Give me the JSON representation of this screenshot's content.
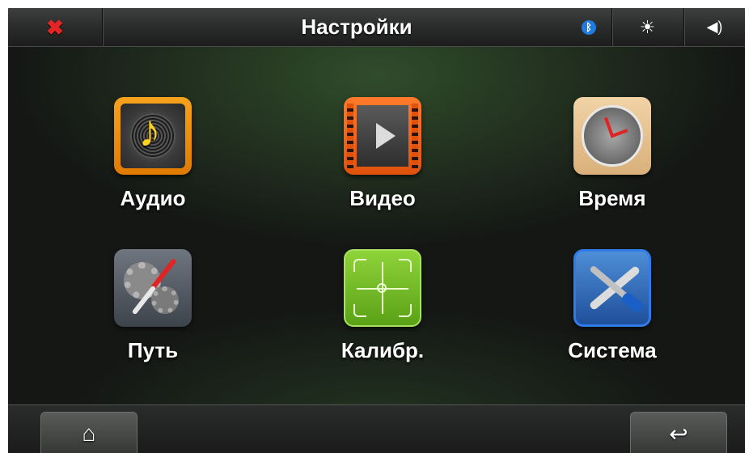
{
  "header": {
    "title": "Настройки",
    "close_icon": "close-icon",
    "bluetooth_icon": "bluetooth-icon",
    "brightness_icon": "brightness-icon",
    "volume_icon": "volume-icon",
    "bluetooth_color": "#1f7be0",
    "close_color": "#e32525"
  },
  "menu": {
    "items": [
      {
        "label": "Аудио",
        "icon": "audio-icon"
      },
      {
        "label": "Видео",
        "icon": "video-icon"
      },
      {
        "label": "Время",
        "icon": "clock-icon"
      },
      {
        "label": "Путь",
        "icon": "compass-icon"
      },
      {
        "label": "Калибр.",
        "icon": "crosshair-icon"
      },
      {
        "label": "Система",
        "icon": "tools-icon"
      }
    ]
  },
  "footer": {
    "home_icon": "home-icon",
    "back_icon": "back-arrow-icon"
  }
}
